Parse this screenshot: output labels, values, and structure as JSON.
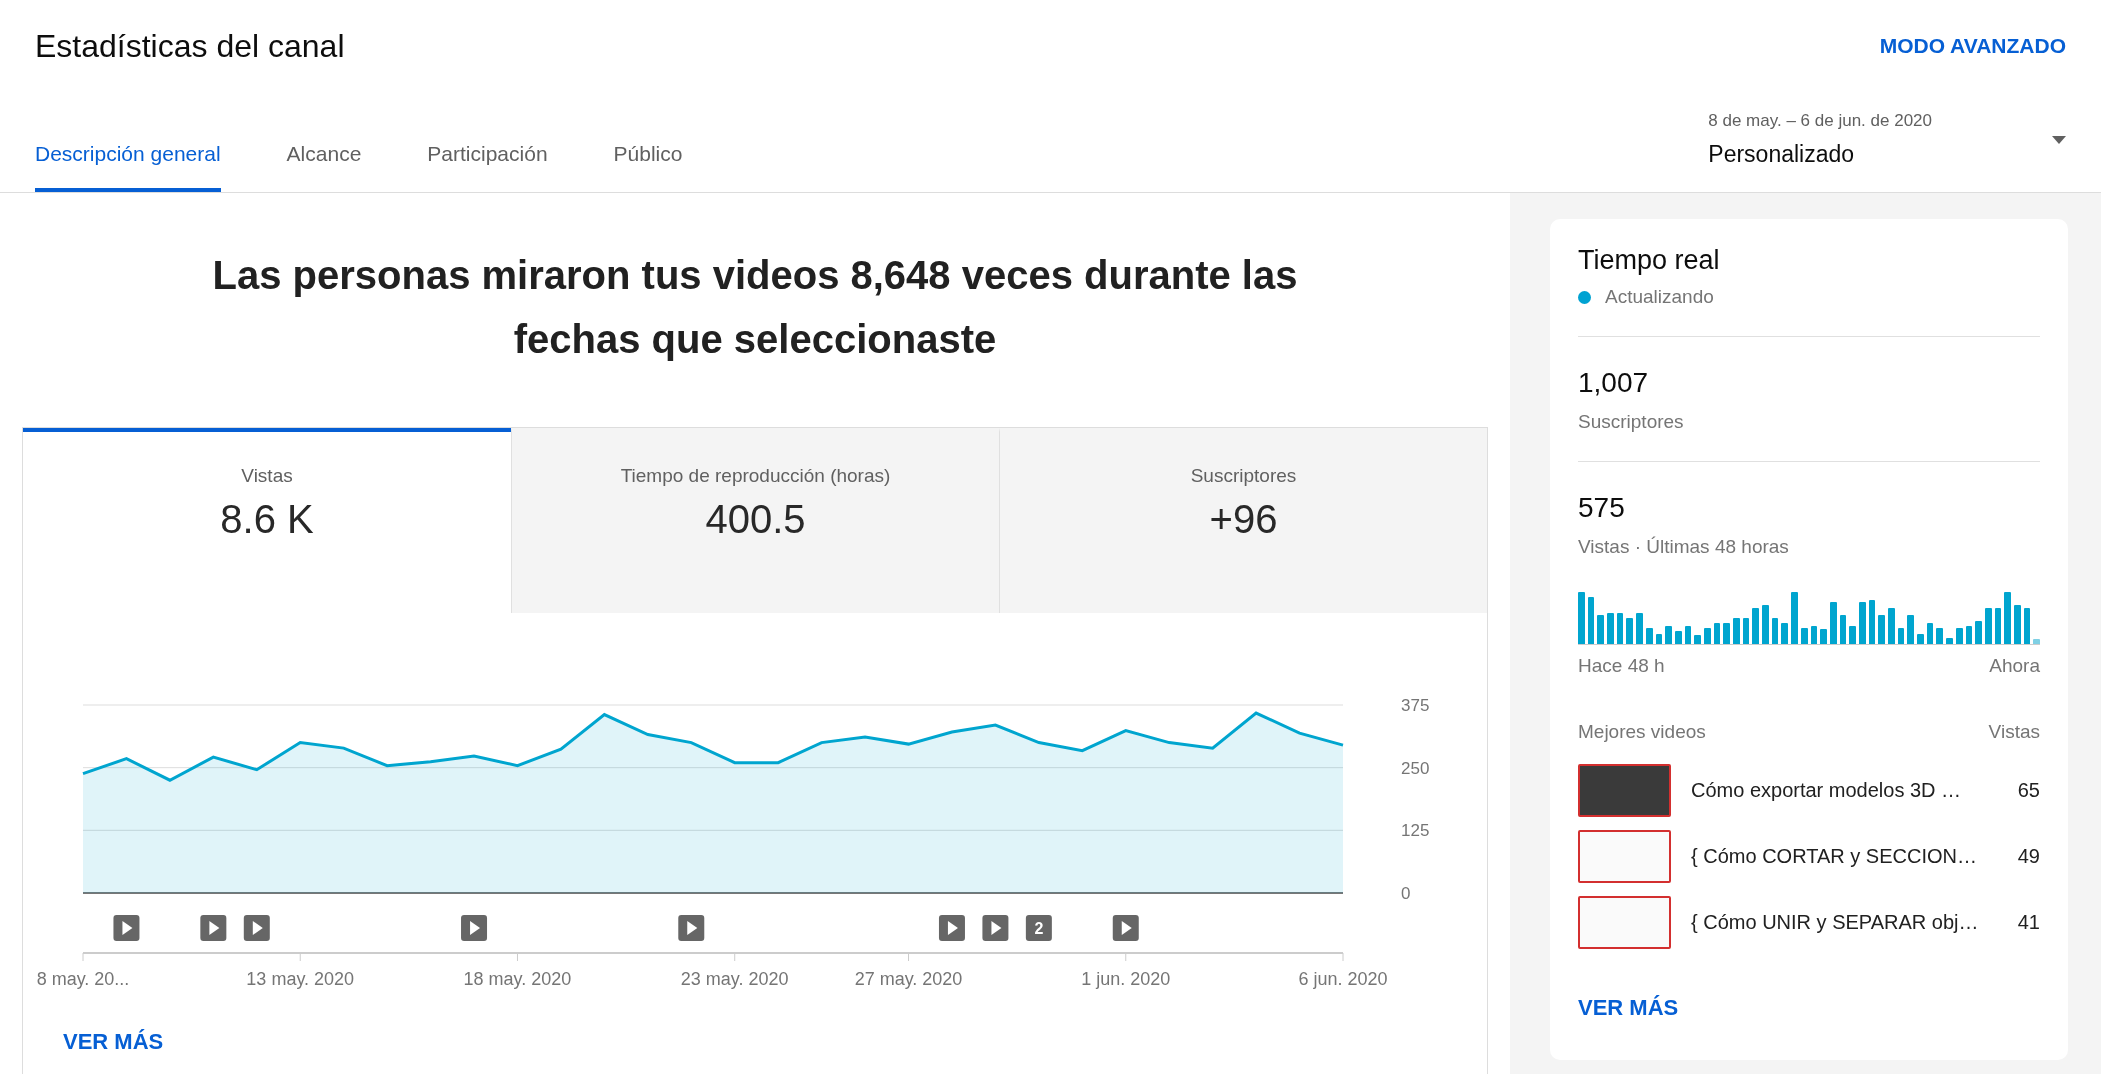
{
  "header": {
    "title": "Estadísticas del canal",
    "advanced_link": "MODO AVANZADO"
  },
  "tabs": [
    {
      "label": "Descripción general",
      "selected": true
    },
    {
      "label": "Alcance",
      "selected": false
    },
    {
      "label": "Participación",
      "selected": false
    },
    {
      "label": "Público",
      "selected": false
    }
  ],
  "date_range": {
    "range": "8 de may. – 6 de jun. de 2020",
    "preset": "Personalizado"
  },
  "headline": "Las personas miraron tus videos 8,648 veces durante las fechas que seleccionaste",
  "metrics": [
    {
      "label": "Vistas",
      "value": "8.6 K",
      "selected": true
    },
    {
      "label": "Tiempo de reproducción (horas)",
      "value": "400.5",
      "selected": false
    },
    {
      "label": "Suscriptores",
      "value": "+96",
      "selected": false
    }
  ],
  "chart_data": {
    "type": "area",
    "categories": [
      "8 may. 20...",
      null,
      null,
      null,
      null,
      "13 may. 2020",
      null,
      null,
      null,
      null,
      "18 may. 2020",
      null,
      null,
      null,
      null,
      "23 may. 2020",
      null,
      null,
      null,
      "27 may. 2020",
      null,
      null,
      null,
      null,
      "1 jun. 2020",
      null,
      null,
      null,
      null,
      "6 jun. 2020"
    ],
    "series": [
      {
        "color": "#00a5cf",
        "values": [
          238,
          268,
          225,
          271,
          246,
          300,
          289,
          254,
          262,
          273,
          254,
          287,
          356,
          316,
          300,
          260,
          260,
          300,
          311,
          297,
          321,
          335,
          300,
          284,
          324,
          300,
          289,
          359,
          319,
          295
        ]
      }
    ],
    "ylim": [
      0,
      375
    ],
    "yticks": [
      0,
      125,
      250,
      375
    ]
  },
  "video_markers": [
    {
      "kind": "none"
    },
    {
      "kind": "play"
    },
    {
      "kind": "none"
    },
    {
      "kind": "play"
    },
    {
      "kind": "play"
    },
    {
      "kind": "none"
    },
    {
      "kind": "none"
    },
    {
      "kind": "none"
    },
    {
      "kind": "none"
    },
    {
      "kind": "play"
    },
    {
      "kind": "none"
    },
    {
      "kind": "none"
    },
    {
      "kind": "none"
    },
    {
      "kind": "none"
    },
    {
      "kind": "play"
    },
    {
      "kind": "none"
    },
    {
      "kind": "none"
    },
    {
      "kind": "none"
    },
    {
      "kind": "none"
    },
    {
      "kind": "none"
    },
    {
      "kind": "play"
    },
    {
      "kind": "play"
    },
    {
      "kind": "count",
      "label": "2"
    },
    {
      "kind": "none"
    },
    {
      "kind": "play"
    },
    {
      "kind": "none"
    },
    {
      "kind": "none"
    },
    {
      "kind": "none"
    },
    {
      "kind": "none"
    },
    {
      "kind": "none"
    }
  ],
  "see_more": "VER MÁS",
  "realtime": {
    "title": "Tiempo real",
    "status": "Actualizando",
    "subscribers": "1,007",
    "subscribers_label": "Suscriptores",
    "views": "575",
    "views_label": "Vistas · Últimas 48 horas",
    "axis_start": "Hace 48 h",
    "axis_end": "Ahora",
    "top_videos_label": "Mejores videos",
    "views_column": "Vistas",
    "top_videos": [
      {
        "title": "Cómo exportar modelos 3D …",
        "views": "65"
      },
      {
        "title": "{ Cómo CORTAR y SECCION…",
        "views": "49"
      },
      {
        "title": "{ Cómo UNIR y SEPARAR obj…",
        "views": "41"
      }
    ],
    "see_more": "VER MÁS"
  }
}
